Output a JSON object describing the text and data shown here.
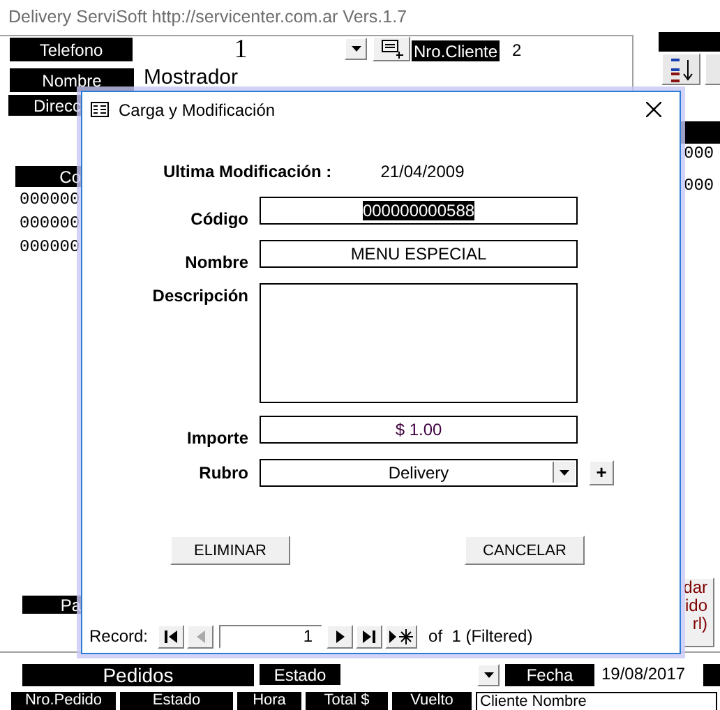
{
  "app_title": "Delivery ServiSoft http://servicenter.com.ar Vers.1.7",
  "background": {
    "telefono_label": "Telefono",
    "telefono_value": "1",
    "nro_cliente_label": "Nro.Cliente",
    "nro_cliente_value": "2",
    "nombre_label": "Nombre",
    "nombre_value": "Mostrador",
    "direccion_label": "Direcc",
    "codigo_header": "Co",
    "left_rows": [
      "000000",
      "000000",
      "000000"
    ],
    "right_rows": [
      "000",
      "000"
    ],
    "pago_label": "Pa",
    "save_button_lines": [
      "dar",
      "ido",
      "rl)"
    ]
  },
  "orders": {
    "title": "Pedidos",
    "estado_label": "Estado",
    "fecha_label": "Fecha",
    "fecha_value": "19/08/2017",
    "columns": [
      "Nro.Pedido",
      "Estado",
      "Hora",
      "Total $",
      "Vuelto",
      "Cliente Nombre"
    ]
  },
  "dialog": {
    "title": "Carga y Modificación",
    "last_modified_label": "Ultima Modificación :",
    "last_modified_value": "21/04/2009",
    "fields": [
      {
        "kind": "text",
        "label": "Código",
        "value": "000000000588",
        "text_highlighted": true
      },
      {
        "kind": "text",
        "label": "Nombre",
        "value": "MENU ESPECIAL"
      },
      {
        "kind": "memo",
        "label": "Descripción"
      },
      {
        "kind": "money",
        "label": "Importe",
        "value": "$ 1.00"
      },
      {
        "kind": "combo",
        "label": "Rubro",
        "value": "Delivery",
        "add_button": "+"
      }
    ],
    "buttons": [
      "ELIMINAR",
      "CANCELAR"
    ],
    "navigator": {
      "label": "Record:",
      "current": "1",
      "total": "of  1 (Filtered)",
      "first_disabled": false,
      "prev_disabled": true,
      "next_disabled": false,
      "last_disabled": false
    }
  }
}
